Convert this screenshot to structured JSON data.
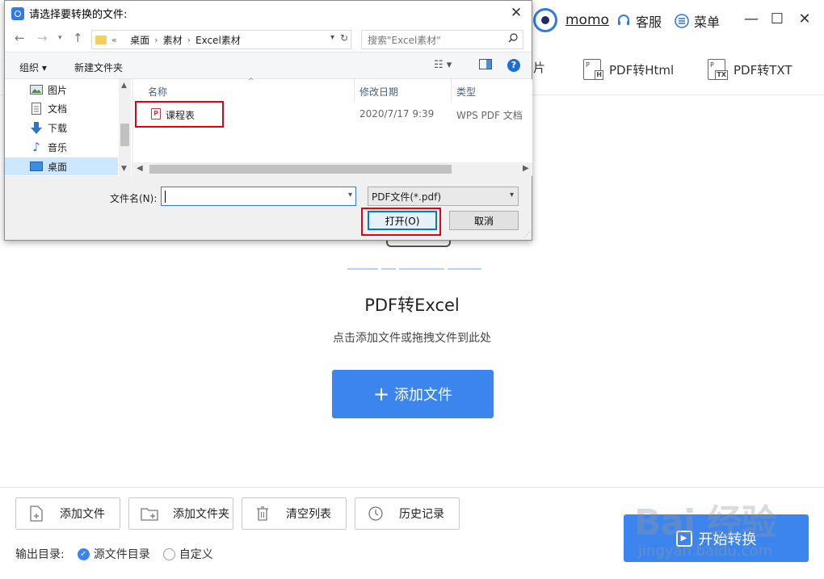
{
  "header": {
    "username": "momo",
    "service_label": "客服",
    "menu_label": "菜单",
    "minimize_glyph": "—",
    "maximize_glyph": "☐",
    "close_glyph": "✕"
  },
  "tool_tabs": [
    {
      "label": "片",
      "icon": "image-doc-icon"
    },
    {
      "label": "PDF转Html",
      "icon": "pdf-html-icon",
      "badge": "H"
    },
    {
      "label": "PDF转TXT",
      "icon": "pdf-txt-icon",
      "badge": "TX"
    }
  ],
  "drop_zone": {
    "title": "PDF转Excel",
    "hint": "点击添加文件或拖拽文件到此处",
    "add_file_label": "添加文件",
    "add_file_plus": "+"
  },
  "bottom_bar": {
    "buttons": [
      {
        "label": "添加文件",
        "icon": "add-file-icon"
      },
      {
        "label": "添加文件夹",
        "icon": "add-folder-icon"
      },
      {
        "label": "清空列表",
        "icon": "trash-icon"
      },
      {
        "label": "历史记录",
        "icon": "history-clock-icon"
      }
    ],
    "output_dir_label": "输出目录:",
    "radio_source": "源文件目录",
    "radio_custom": "自定义",
    "selected_radio": "源文件目录",
    "start_label": "开始转换"
  },
  "watermark": {
    "text": "Bai 经验",
    "sub": "jingyan.baidu.com"
  },
  "dialog": {
    "title": "请选择要转换的文件:",
    "close_glyph": "✕",
    "breadcrumb_prefix": "«",
    "breadcrumbs": [
      "桌面",
      "素材",
      "Excel素材"
    ],
    "crumb_sep": "›",
    "search_placeholder": "搜索\"Excel素材\"",
    "organize_label": "组织 ▾",
    "new_folder_label": "新建文件夹",
    "help_glyph": "?",
    "nav_items": [
      {
        "label": "图片",
        "icon": "pictures-icon"
      },
      {
        "label": "文档",
        "icon": "documents-icon"
      },
      {
        "label": "下载",
        "icon": "download-icon"
      },
      {
        "label": "音乐",
        "icon": "music-icon"
      },
      {
        "label": "桌面",
        "icon": "desktop-icon",
        "selected": true
      }
    ],
    "columns": {
      "name": "名称",
      "modified": "修改日期",
      "type": "类型"
    },
    "files": [
      {
        "name": "课程表",
        "modified": "2020/7/17 9:39",
        "type": "WPS PDF 文档"
      }
    ],
    "filename_label": "文件名(N):",
    "filename_value": "",
    "filetype_value": "PDF文件(*.pdf)",
    "open_label": "打开(O)",
    "cancel_label": "取消"
  },
  "colors": {
    "accent": "#3d85ee",
    "highlight_red": "#e60012",
    "nav_selected": "#cce8ff"
  }
}
